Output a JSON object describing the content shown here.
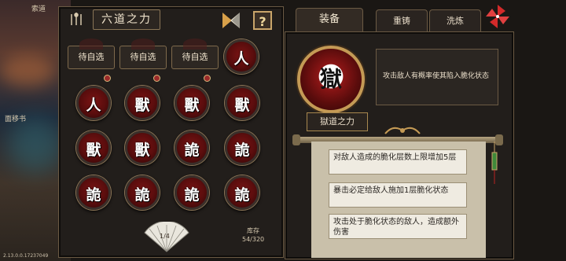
{
  "side": {
    "top_text": "索道",
    "mid_text": "面移书",
    "version": "2.13.0.0.17237049"
  },
  "left": {
    "title": "六道之力",
    "help_label": "?",
    "pending_label": "待自选",
    "slot4_glyph": "人",
    "grid": [
      "人",
      "獸",
      "獸",
      "獸",
      "獸",
      "獸",
      "詭",
      "詭",
      "詭",
      "詭",
      "詭",
      "詭"
    ],
    "page_indicator": "1/4",
    "stock_label": "库存",
    "stock_value": "54/320"
  },
  "right": {
    "tabs": [
      "装备",
      "重铸",
      "洗炼"
    ],
    "selected_glyph": "獄",
    "selected_name": "獄道之力",
    "selected_desc": "攻击敌人有概率使其陷入脆化状态",
    "affixes": [
      "对敌人造成的脆化层数上限增加5层",
      "暴击必定给敌人施加1层脆化状态",
      "攻击处于脆化状态的敌人，造成额外伤害"
    ]
  },
  "colors": {
    "panel_border": "#6b5a44",
    "orb_red": "#7b1414",
    "gold": "#c49a55"
  },
  "icons": [
    "fork-icon",
    "triangle-icon",
    "question-icon",
    "pinwheel-icon",
    "fan-icon",
    "lock-icon"
  ]
}
